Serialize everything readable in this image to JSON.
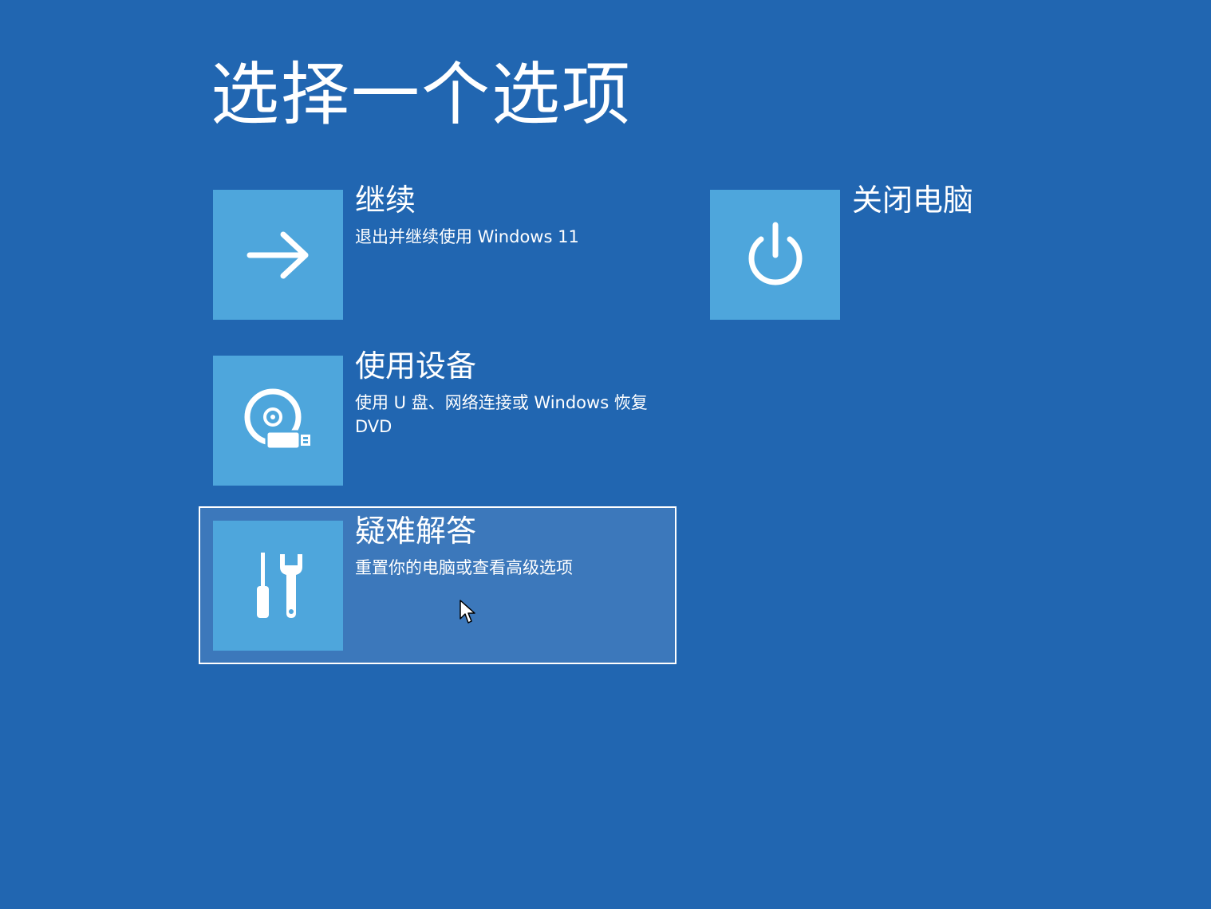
{
  "screen": {
    "title": "选择一个选项",
    "background_color": "#2166b1",
    "tile_color": "#4ea6dc",
    "focus_color": "#3c78bb"
  },
  "options": {
    "continue": {
      "label": "继续",
      "description": "退出并继续使用 Windows 11",
      "icon": "arrow-right-icon"
    },
    "use_device": {
      "label": "使用设备",
      "description": "使用 U 盘、网络连接或 Windows 恢复 DVD",
      "icon": "disc-usb-icon"
    },
    "troubleshoot": {
      "label": "疑难解答",
      "description": "重置你的电脑或查看高级选项",
      "icon": "tools-icon",
      "selected": true
    },
    "shutdown": {
      "label": "关闭电脑",
      "icon": "power-icon"
    }
  }
}
